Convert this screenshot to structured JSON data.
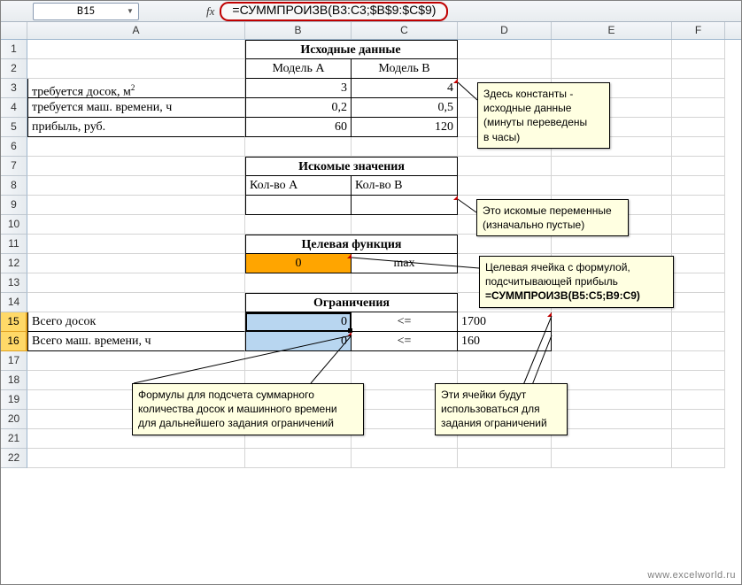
{
  "namebox": "B15",
  "fx_label": "fx",
  "formula": "=СУММПРОИЗВ(B3:C3;$B$9:$C$9)",
  "columns": [
    "A",
    "B",
    "C",
    "D",
    "E",
    "F"
  ],
  "rows": [
    "1",
    "2",
    "3",
    "4",
    "5",
    "6",
    "7",
    "8",
    "9",
    "10",
    "11",
    "12",
    "13",
    "14",
    "15",
    "16",
    "17",
    "18",
    "19",
    "20",
    "21",
    "22"
  ],
  "h1": "Исходные данные",
  "h1a": "Модель A",
  "h1b": "Модель B",
  "r3a": "требуется досок, м",
  "r3b": "3",
  "r3c": "4",
  "r4a": "требуется маш. времени, ч",
  "r4b": "0,2",
  "r4c": "0,5",
  "r5a": "прибыль, руб.",
  "r5b": "60",
  "r5c": "120",
  "h2": "Искомые значения",
  "h2a": "Кол-во A",
  "h2b": "Кол-во B",
  "h3": "Целевая функция",
  "r12b": "0",
  "r12c": "max",
  "h4": "Ограничения",
  "r15a": "Всего досок",
  "r15b": "0",
  "r15c": "<=",
  "r15d": "1700",
  "r16a": "Всего маш. времени, ч",
  "r16b": "0",
  "r16c": "<=",
  "r16d": "160",
  "sup2": "2",
  "c1l1": "Здесь константы -",
  "c1l2": "исходные данные",
  "c1l3": "(минуты переведены",
  "c1l4": "в часы)",
  "c2l1": "Это искомые переменные",
  "c2l2": "(изначально пустые)",
  "c3l1": "Целевая ячейка с формулой,",
  "c3l2": "подсчитывающей прибыль",
  "c3l3": "=СУММПРОИЗВ(B5:C5;B9:C9)",
  "c4l1": "Формулы для подсчета суммарного",
  "c4l2": "количества досок и машинного времени",
  "c4l3": "для дальнейшего задания ограничений",
  "c5l1": "Эти ячейки будут",
  "c5l2": "использоваться для",
  "c5l3": "задания ограничений",
  "watermark": "www.excelworld.ru"
}
